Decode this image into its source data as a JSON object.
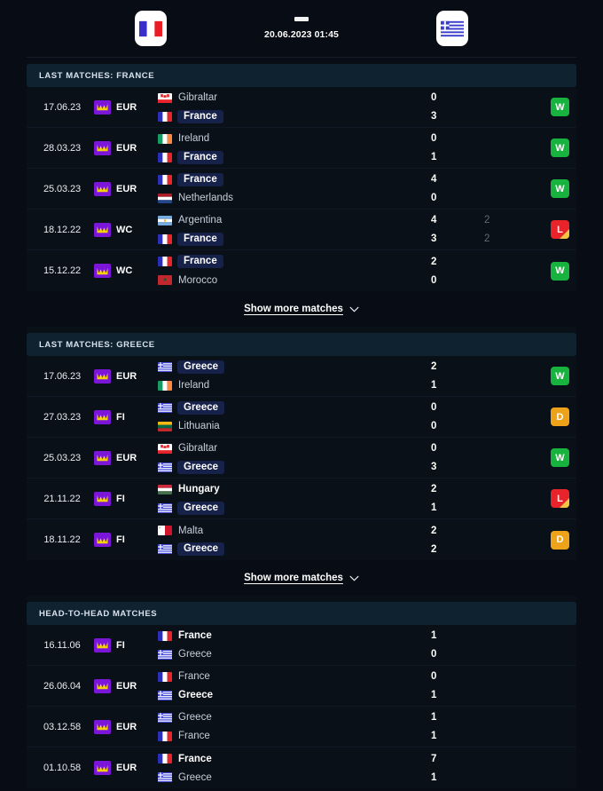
{
  "header": {
    "home_team": "France",
    "away_team": "Greece",
    "score_separator": "-",
    "kickoff": "20.06.2023 01:45"
  },
  "sections": [
    {
      "id": "last-matches-france",
      "title": "LAST MATCHES: FRANCE",
      "show_more_label": "Show more matches",
      "matches": [
        {
          "date": "17.06.23",
          "competition": "EUR",
          "home": "Gibraltar",
          "away": "France",
          "home_flag": "gibraltar",
          "away_flag": "france",
          "home_score": "0",
          "away_score": "3",
          "home_pens": "",
          "away_pens": "",
          "home_style": "normal",
          "away_style": "highlight",
          "result": "W"
        },
        {
          "date": "28.03.23",
          "competition": "EUR",
          "home": "Ireland",
          "away": "France",
          "home_flag": "ireland",
          "away_flag": "france",
          "home_score": "0",
          "away_score": "1",
          "home_pens": "",
          "away_pens": "",
          "home_style": "normal",
          "away_style": "highlight",
          "result": "W"
        },
        {
          "date": "25.03.23",
          "competition": "EUR",
          "home": "France",
          "away": "Netherlands",
          "home_flag": "france",
          "away_flag": "netherlands",
          "home_score": "4",
          "away_score": "0",
          "home_pens": "",
          "away_pens": "",
          "home_style": "highlight",
          "away_style": "normal",
          "result": "W"
        },
        {
          "date": "18.12.22",
          "competition": "WC",
          "home": "Argentina",
          "away": "France",
          "home_flag": "argentina",
          "away_flag": "france",
          "home_score": "4",
          "away_score": "3",
          "home_pens": "2",
          "away_pens": "2",
          "home_style": "normal",
          "away_style": "highlight",
          "result": "L"
        },
        {
          "date": "15.12.22",
          "competition": "WC",
          "home": "France",
          "away": "Morocco",
          "home_flag": "france",
          "away_flag": "morocco",
          "home_score": "2",
          "away_score": "0",
          "home_pens": "",
          "away_pens": "",
          "home_style": "highlight",
          "away_style": "normal",
          "result": "W"
        }
      ]
    },
    {
      "id": "last-matches-greece",
      "title": "LAST MATCHES: GREECE",
      "show_more_label": "Show more matches",
      "matches": [
        {
          "date": "17.06.23",
          "competition": "EUR",
          "home": "Greece",
          "away": "Ireland",
          "home_flag": "greece",
          "away_flag": "ireland",
          "home_score": "2",
          "away_score": "1",
          "home_pens": "",
          "away_pens": "",
          "home_style": "highlight",
          "away_style": "normal",
          "result": "W"
        },
        {
          "date": "27.03.23",
          "competition": "FI",
          "home": "Greece",
          "away": "Lithuania",
          "home_flag": "greece",
          "away_flag": "lithuania",
          "home_score": "0",
          "away_score": "0",
          "home_pens": "",
          "away_pens": "",
          "home_style": "highlight",
          "away_style": "normal",
          "result": "D"
        },
        {
          "date": "25.03.23",
          "competition": "EUR",
          "home": "Gibraltar",
          "away": "Greece",
          "home_flag": "gibraltar",
          "away_flag": "greece",
          "home_score": "0",
          "away_score": "3",
          "home_pens": "",
          "away_pens": "",
          "home_style": "normal",
          "away_style": "highlight",
          "result": "W"
        },
        {
          "date": "21.11.22",
          "competition": "FI",
          "home": "Hungary",
          "away": "Greece",
          "home_flag": "hungary",
          "away_flag": "greece",
          "home_score": "2",
          "away_score": "1",
          "home_pens": "",
          "away_pens": "",
          "home_style": "winner",
          "away_style": "highlight",
          "result": "L"
        },
        {
          "date": "18.11.22",
          "competition": "FI",
          "home": "Malta",
          "away": "Greece",
          "home_flag": "malta",
          "away_flag": "greece",
          "home_score": "2",
          "away_score": "2",
          "home_pens": "",
          "away_pens": "",
          "home_style": "normal",
          "away_style": "highlight",
          "result": "D"
        }
      ]
    },
    {
      "id": "head-to-head-matches",
      "title": "HEAD-TO-HEAD MATCHES",
      "show_more_label": "",
      "matches": [
        {
          "date": "16.11.06",
          "competition": "FI",
          "home": "France",
          "away": "Greece",
          "home_flag": "france",
          "away_flag": "greece",
          "home_score": "1",
          "away_score": "0",
          "home_pens": "",
          "away_pens": "",
          "home_style": "winner",
          "away_style": "normal",
          "result": ""
        },
        {
          "date": "26.06.04",
          "competition": "EUR",
          "home": "France",
          "away": "Greece",
          "home_flag": "france",
          "away_flag": "greece",
          "home_score": "0",
          "away_score": "1",
          "home_pens": "",
          "away_pens": "",
          "home_style": "normal",
          "away_style": "winner",
          "result": ""
        },
        {
          "date": "03.12.58",
          "competition": "EUR",
          "home": "Greece",
          "away": "France",
          "home_flag": "greece",
          "away_flag": "france",
          "home_score": "1",
          "away_score": "1",
          "home_pens": "",
          "away_pens": "",
          "home_style": "normal",
          "away_style": "normal",
          "result": ""
        },
        {
          "date": "01.10.58",
          "competition": "EUR",
          "home": "France",
          "away": "Greece",
          "home_flag": "france",
          "away_flag": "greece",
          "home_score": "7",
          "away_score": "1",
          "home_pens": "",
          "away_pens": "",
          "home_style": "winner",
          "away_style": "normal",
          "result": ""
        }
      ]
    }
  ],
  "colors": {
    "win": "#17b33e",
    "draw": "#eda21a",
    "loss": "#e8232a",
    "competition_badge": "#7b16d9",
    "highlight_pill": "#17224a"
  }
}
